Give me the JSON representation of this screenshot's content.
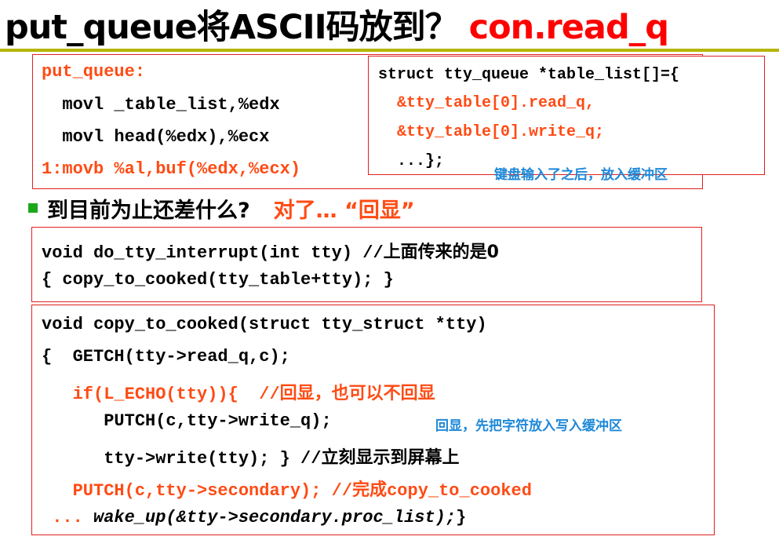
{
  "title": {
    "prefix": "put_queue将ASCII码放到？",
    "highlight": "con.read_q"
  },
  "box1": {
    "lines": [
      "put_queue:",
      "  movl _table_list,%edx",
      "  movl head(%edx),%ecx",
      "1:movb %al,buf(%edx,%ecx)"
    ]
  },
  "box2": {
    "line1": "struct tty_queue *table_list[]={",
    "line2": "  &tty_table[0].read_q,",
    "line3": "  &tty_table[0].write_q;",
    "line4": "  ...};",
    "note": "键盘输入了之后，放入缓冲区"
  },
  "bullet": {
    "text": "到目前为止还差什么?",
    "answer": "对了… “回显”"
  },
  "box3": {
    "line1_code": "void do_tty_interrupt(int tty) //",
    "line1_cn": "上面传来的是0",
    "line2": "{ copy_to_cooked(tty_table+tty); }"
  },
  "box4": {
    "l1": "void copy_to_cooked(struct tty_struct *tty)",
    "l2": "{  GETCH(tty->read_q,c);",
    "l3_code": "   if(L_ECHO(tty)){  //",
    "l3_cn": "回显，也可以不回显",
    "l4": "      PUTCH(c,tty->write_q);",
    "l4_note": "回显，先把字符放入写入缓冲区",
    "l5_code": "      tty->write(tty); } //",
    "l5_cn": "立刻显示到屏幕上",
    "l6_code": "   PUTCH(c,tty->secondary); //",
    "l6_cn": "完成",
    "l6_tail": "copy_to_cooked",
    "l7_dots": " ...",
    "l7_code": " wake_up(&tty->secondary.proc_list);",
    "l7_end": "}"
  }
}
